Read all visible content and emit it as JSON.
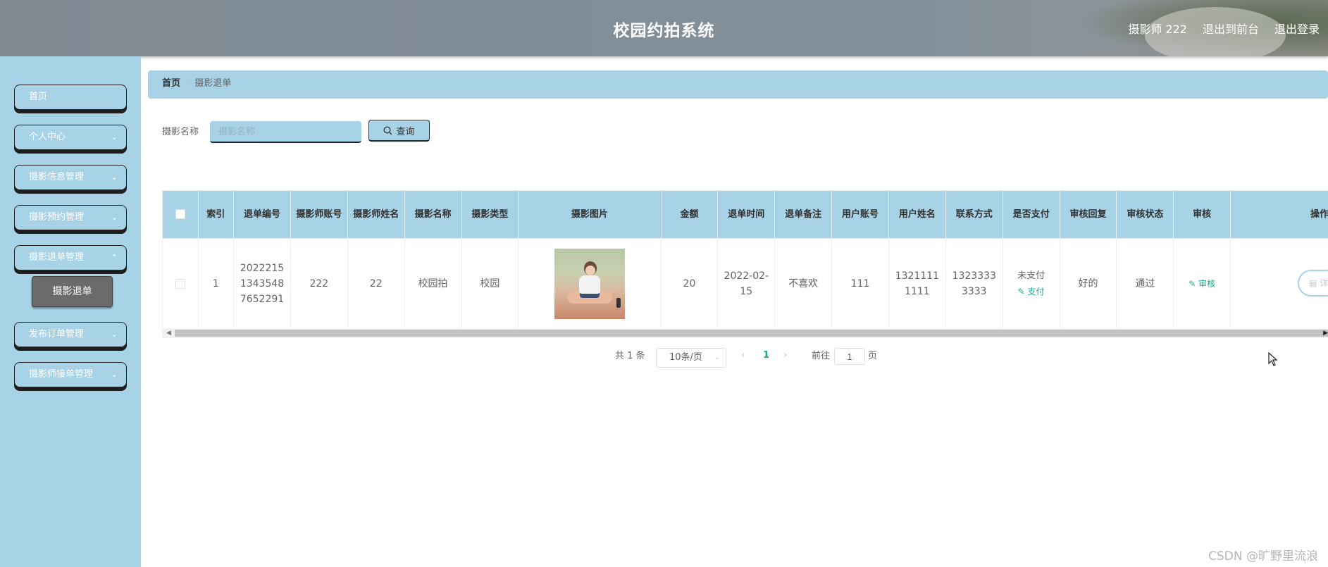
{
  "header": {
    "title": "校园约拍系统",
    "user": "摄影师 222",
    "to_front": "退出到前台",
    "logout": "退出登录"
  },
  "sidebar": {
    "items": [
      {
        "label": "首页",
        "has_children": false
      },
      {
        "label": "个人中心",
        "has_children": true
      },
      {
        "label": "摄影信息管理",
        "has_children": true
      },
      {
        "label": "摄影预约管理",
        "has_children": true
      },
      {
        "label": "摄影退单管理",
        "has_children": true
      },
      {
        "label": "发布订单管理",
        "has_children": true
      },
      {
        "label": "摄影师接单管理",
        "has_children": true
      }
    ],
    "active_sub": "摄影退单"
  },
  "breadcrumb": {
    "home": "首页",
    "current": "摄影退单"
  },
  "search": {
    "label": "摄影名称",
    "placeholder": "摄影名称",
    "button": "查询"
  },
  "table": {
    "columns": [
      "索引",
      "退单编号",
      "摄影师账号",
      "摄影师姓名",
      "摄影名称",
      "摄影类型",
      "摄影图片",
      "金额",
      "退单时间",
      "退单备注",
      "用户账号",
      "用户姓名",
      "联系方式",
      "是否支付",
      "审核回复",
      "审核状态",
      "审核",
      "操作"
    ],
    "rows": [
      {
        "index": "1",
        "refund_no": "20222151343548765229​1",
        "photographer_account": "222",
        "photographer_name": "22",
        "photo_name": "校园拍",
        "photo_type": "校园",
        "amount": "20",
        "refund_time": "2022-02-15",
        "refund_note": "不喜欢",
        "user_account": "111",
        "user_name": "13211111111",
        "contact": "13233333333",
        "paid": "未支付",
        "pay_action": "支付",
        "review_reply": "好的",
        "review_status": "通过",
        "review_action": "审核",
        "detail_action": "详"
      }
    ]
  },
  "pagination": {
    "total": "共 1 条",
    "page_size": "10条/页",
    "current_page": "1",
    "goto_prefix": "前往",
    "goto_value": "1",
    "goto_suffix": "页"
  },
  "watermark": "CSDN @旷野里流浪",
  "colors": {
    "accent": "#a8d2e5",
    "link": "#1aab8a",
    "header": "#7f8a93"
  }
}
